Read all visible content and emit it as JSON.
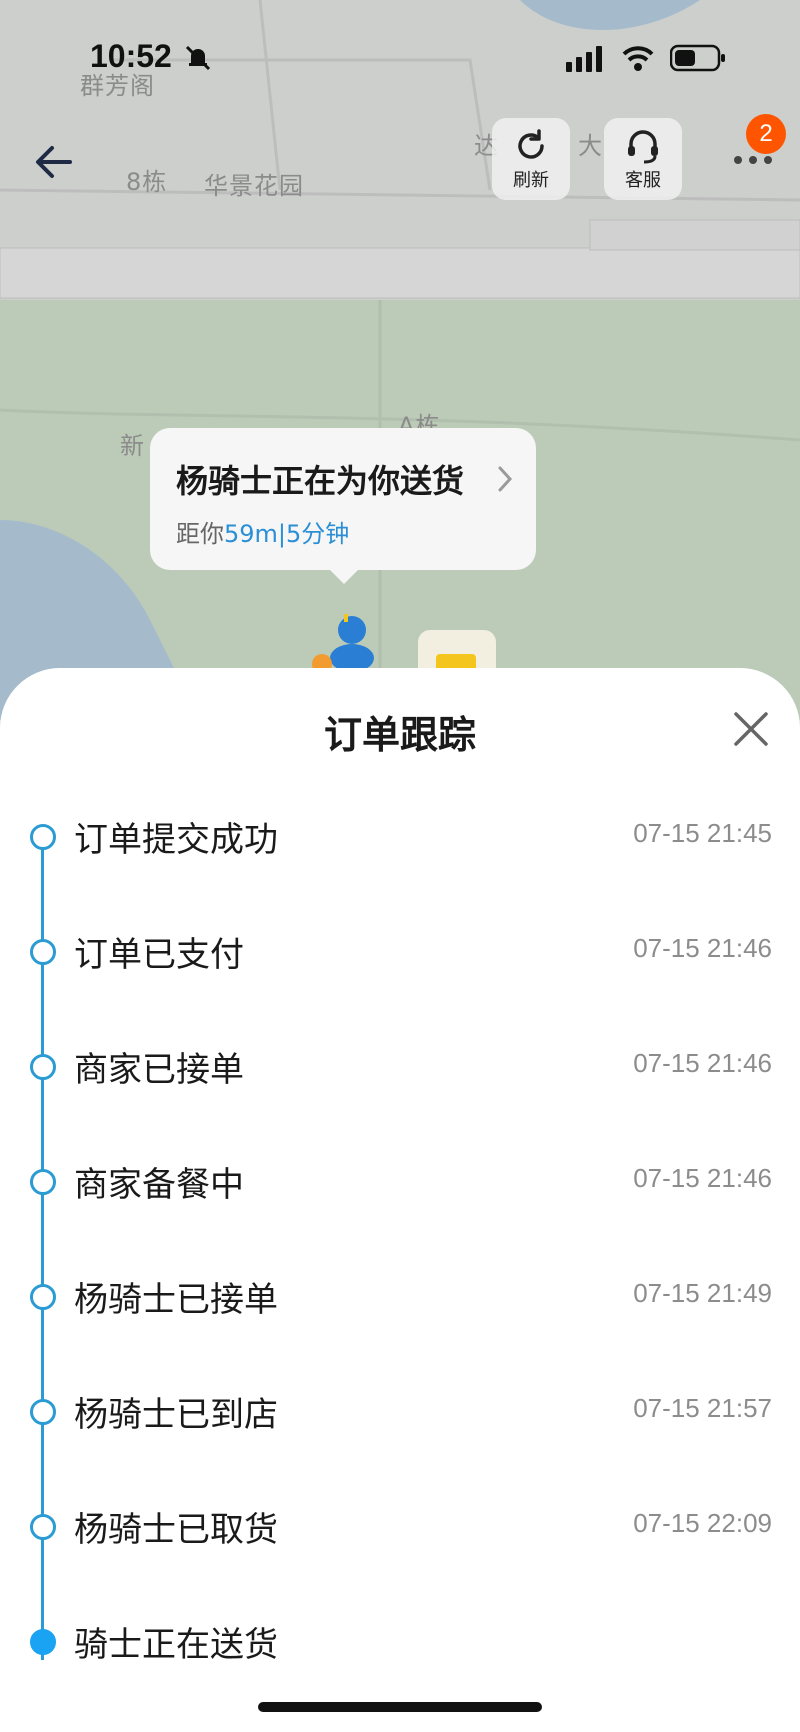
{
  "status_bar": {
    "time": "10:52"
  },
  "map": {
    "labels": [
      "群芳阁",
      "8栋",
      "华景花园",
      "新",
      "A栋",
      "达",
      "大"
    ]
  },
  "nav": {
    "refresh_label": "刷新",
    "service_label": "客服",
    "badge_count": "2"
  },
  "rider_bubble": {
    "title": "杨骑士正在为你送货",
    "distance_prefix": "距你",
    "distance": "59m",
    "separator": "|",
    "eta": "5分钟"
  },
  "sheet": {
    "title": "订单跟踪",
    "steps": [
      {
        "label": "订单提交成功",
        "time": "07-15 21:45"
      },
      {
        "label": "订单已支付",
        "time": "07-15 21:46"
      },
      {
        "label": "商家已接单",
        "time": "07-15 21:46"
      },
      {
        "label": "商家备餐中",
        "time": "07-15 21:46"
      },
      {
        "label": "杨骑士已接单",
        "time": "07-15 21:49"
      },
      {
        "label": "杨骑士已到店",
        "time": "07-15 21:57"
      },
      {
        "label": "杨骑士已取货",
        "time": "07-15 22:09"
      },
      {
        "label": "骑士正在送货",
        "time": ""
      }
    ],
    "active_step": 7
  },
  "colors": {
    "accent": "#2a9bd3",
    "active_dot": "#1aa3f2",
    "badge": "#ff5500",
    "link": "#2b8fd6"
  }
}
